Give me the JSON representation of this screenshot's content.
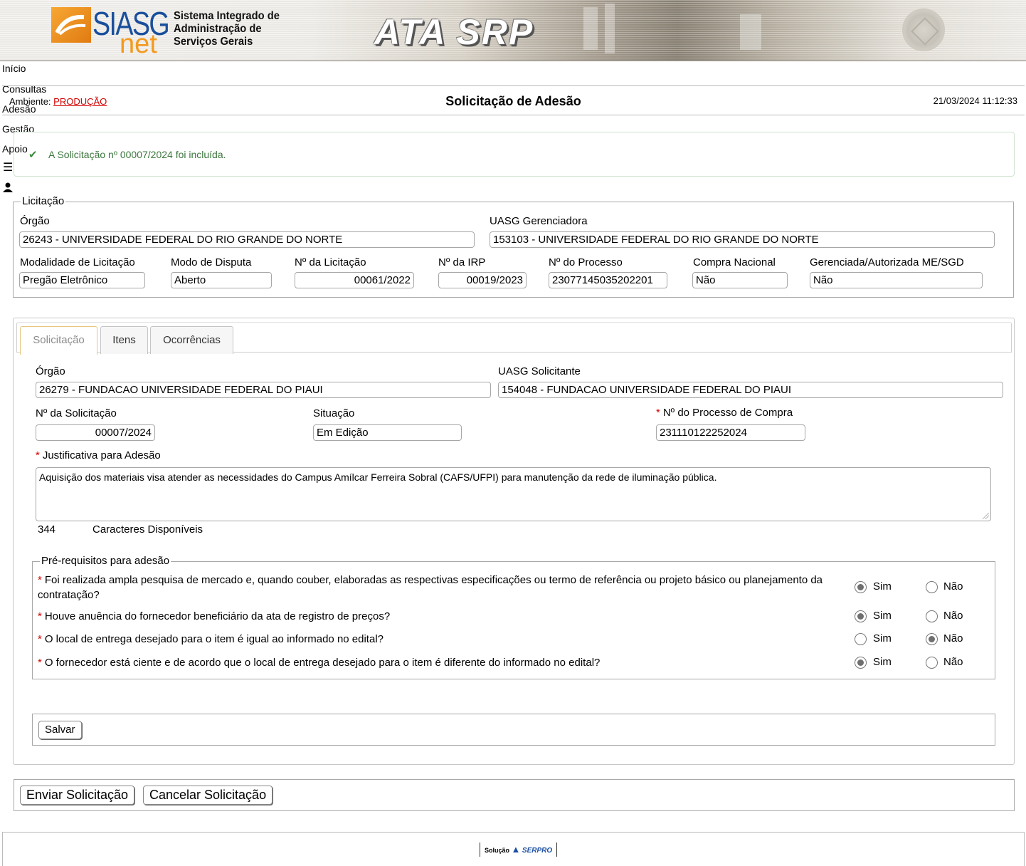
{
  "banner": {
    "logo_siasg": "SIASG",
    "logo_net": "net",
    "logo_text_line1": "Sistema Integrado de",
    "logo_text_line2": "Administração de",
    "logo_text_line3": "Serviços Gerais",
    "app_title": "ATA SRP"
  },
  "menu": {
    "items": [
      "Início",
      "Consultas",
      "Adesão",
      "Gestão",
      "Apoio"
    ],
    "hamburger_icon": "menu-icon",
    "user_icon": "user-icon"
  },
  "header": {
    "env_label": "Ambiente: ",
    "env_value": "PRODUÇÃO",
    "title": "Solicitação de Adesão",
    "datetime": "21/03/2024 11:12:33"
  },
  "message": {
    "icon": "check-icon",
    "text": "A Solicitação nº 00007/2024 foi incluída."
  },
  "licitacao": {
    "legend": "Licitação",
    "orgao_label": "Órgão",
    "orgao_value": "26243 - UNIVERSIDADE FEDERAL DO RIO GRANDE DO NORTE",
    "uasg_label": "UASG Gerenciadora",
    "uasg_value": "153103 - UNIVERSIDADE FEDERAL DO RIO GRANDE DO NORTE",
    "modalidade_label": "Modalidade de Licitação",
    "modalidade_value": "Pregão Eletrônico",
    "modo_label": "Modo de Disputa",
    "modo_value": "Aberto",
    "num_licitacao_label": "Nº da Licitação",
    "num_licitacao_value": "00061/2022",
    "num_irp_label": "Nº da IRP",
    "num_irp_value": "00019/2023",
    "num_processo_label": "Nº do Processo",
    "num_processo_value": "23077145035202201",
    "compra_nacional_label": "Compra Nacional",
    "compra_nacional_value": "Não",
    "gerenciada_label": "Gerenciada/Autorizada ME/SGD",
    "gerenciada_value": "Não"
  },
  "tabs": [
    {
      "label": "Solicitação",
      "active": true
    },
    {
      "label": "Itens",
      "active": false
    },
    {
      "label": "Ocorrências",
      "active": false
    }
  ],
  "solicitacao": {
    "orgao_label": "Órgão",
    "orgao_value": "26279 - FUNDACAO UNIVERSIDADE FEDERAL DO PIAUI",
    "uasg_label": "UASG Solicitante",
    "uasg_value": "154048 - FUNDACAO UNIVERSIDADE FEDERAL DO PIAUI",
    "num_solicitacao_label": "Nº da Solicitação",
    "num_solicitacao_value": "00007/2024",
    "situacao_label": "Situação",
    "situacao_value": "Em Edição",
    "processo_compra_label": "Nº do Processo de Compra",
    "processo_compra_value": "231110122252024",
    "justificativa_label": "Justificativa para Adesão",
    "justificativa_value": "Aquisição dos materiais visa atender as necessidades do Campus Amílcar Ferreira Sobral (CAFS/UFPI) para manutenção da rede de iluminação pública.",
    "chars_count": "344",
    "chars_label": "Caracteres Disponíveis",
    "required_mark": "*"
  },
  "prerequisitos": {
    "legend": "Pré-requisitos para adesão",
    "sim_label": "Sim",
    "nao_label": "Não",
    "questions": [
      {
        "text": "Foi realizada ampla pesquisa de mercado e, quando couber, elaboradas as respectivas especificações ou termo de referência ou projeto básico ou planejamento da contratação?",
        "answer": "Sim"
      },
      {
        "text": "Houve anuência do fornecedor beneficiário da ata de registro de preços?",
        "answer": "Sim"
      },
      {
        "text": "O local de entrega desejado para o item é igual ao informado no edital?",
        "answer": "Não"
      },
      {
        "text": "O fornecedor está ciente e de acordo que o local de entrega desejado para o item é diferente do informado no edital?",
        "answer": "Sim"
      }
    ]
  },
  "buttons": {
    "salvar": "Salvar",
    "enviar": "Enviar Solicitação",
    "cancelar": "Cancelar Solicitação"
  },
  "footer": {
    "solucao": "Solução",
    "serpro": "SERPRO"
  }
}
